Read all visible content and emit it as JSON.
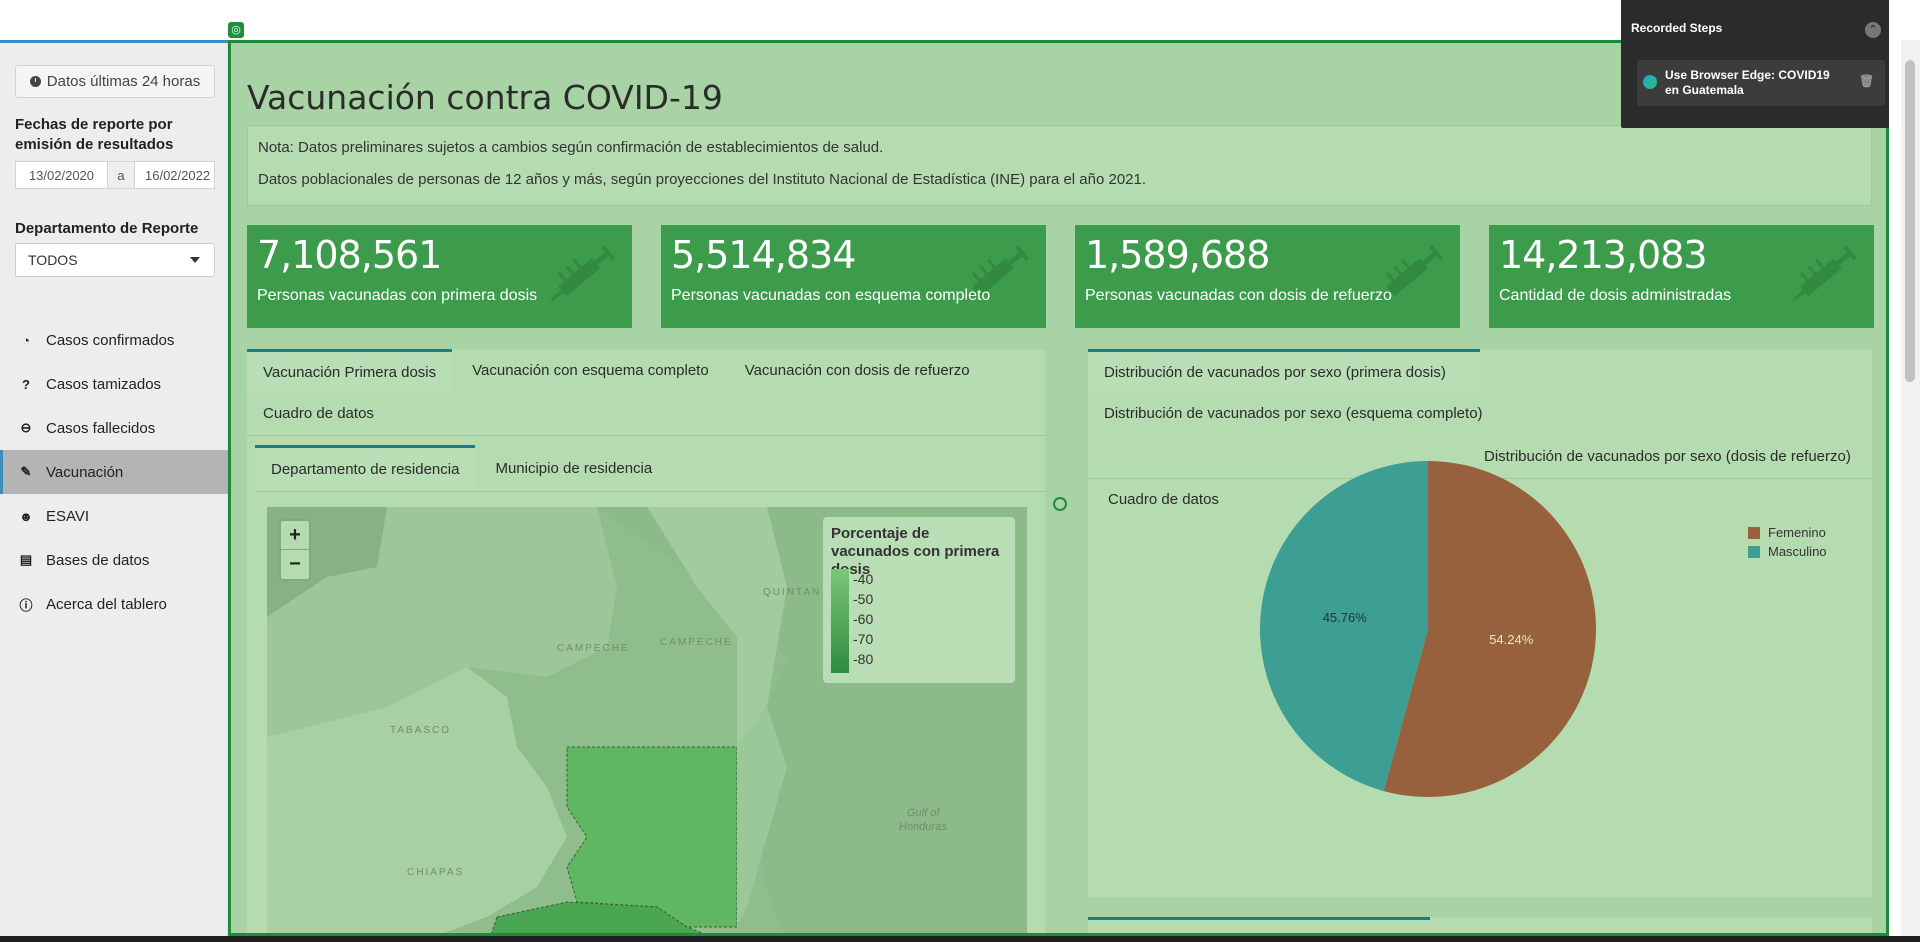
{
  "sidebar": {
    "btn_24h": "Datos últimas 24 horas",
    "dates_label": "Fechas de reporte por emisión de resultados",
    "date_from": "13/02/2020",
    "date_sep": "a",
    "date_to": "16/02/2022",
    "dept_label": "Departamento de Reporte",
    "dept_value": "TODOS",
    "items": [
      {
        "label": "Casos confirmados",
        "icon": "dashboard-icon"
      },
      {
        "label": "Casos tamizados",
        "icon": "question-icon"
      },
      {
        "label": "Casos fallecidos",
        "icon": "minus-circle-icon"
      },
      {
        "label": "Vacunación",
        "icon": "syringe-icon"
      },
      {
        "label": "ESAVI",
        "icon": "user-alert-icon"
      },
      {
        "label": "Bases de datos",
        "icon": "file-icon"
      },
      {
        "label": "Acerca del tablero",
        "icon": "info-icon"
      }
    ]
  },
  "main": {
    "title": "Vacunación contra COVID-19",
    "note1": "Nota: Datos preliminares sujetos a cambios según confirmación de establecimientos de salud.",
    "note2": "Datos poblacionales de personas de 12 años y más, según proyecciones del Instituto Nacional de Estadística (INE) para el año 2021.",
    "kpis": [
      {
        "value": "7,108,561",
        "label": "Personas vacunadas con primera dosis"
      },
      {
        "value": "5,514,834",
        "label": "Personas vacunadas con esquema completo"
      },
      {
        "value": "1,589,688",
        "label": "Personas vacunadas con dosis de refuerzo"
      },
      {
        "value": "14,213,083",
        "label": "Cantidad de dosis administradas"
      }
    ],
    "left_tabs": [
      "Vacunación Primera dosis",
      "Vacunación con esquema completo",
      "Vacunación con dosis de refuerzo",
      "Cuadro de datos"
    ],
    "sub_tabs": [
      "Departamento de residencia",
      "Municipio de residencia"
    ],
    "right_tabs": [
      "Distribución de vacunados por sexo (primera dosis)",
      "Distribución de vacunados por sexo (esquema completo)",
      "Distribución de vacunados por sexo (dosis de refuerzo)",
      "Cuadro de datos"
    ],
    "map": {
      "zoom_in": "+",
      "zoom_out": "−",
      "legend_title": "Porcentaje de vacunados con primera dosis",
      "legend_ticks": [
        "40",
        "50",
        "60",
        "70",
        "80"
      ],
      "labels": {
        "campeche1": "CAMPECHE",
        "campeche2": "CAMPECHE",
        "quintana": "QUINTAN",
        "tabasco": "TABASCO",
        "chiapas": "CHIAPAS",
        "gulf1": "Gulf of",
        "gulf2": "Honduras"
      }
    }
  },
  "chart_data": {
    "type": "pie",
    "labels": [
      "Femenino",
      "Masculino"
    ],
    "values": [
      54.24,
      45.76
    ],
    "value_labels": [
      "54.24%",
      "45.76%"
    ],
    "colors": [
      "#96613c",
      "#3d9e93"
    ],
    "legend_position": "top-right"
  },
  "recorder": {
    "title": "Recorded Steps",
    "step": "Use Browser Edge: COVID19 en Guatemala"
  }
}
